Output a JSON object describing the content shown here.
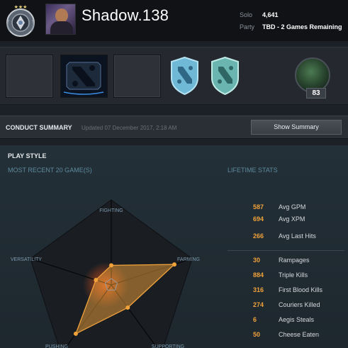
{
  "header": {
    "player_name": "Shadow.138",
    "stats": [
      {
        "label": "Solo",
        "value": "4,641"
      },
      {
        "label": "Party",
        "value": "TBD - 2 Games Remaining"
      }
    ],
    "rank_icon": "rank-medal-icon",
    "avatar_icon": "player-avatar"
  },
  "showcase": {
    "hero_level": "83",
    "hero_icon": "hero-portrait"
  },
  "conduct": {
    "title": "CONDUCT SUMMARY",
    "updated": "Updated 07 December 2017, 2:18 AM",
    "button_label": "Show Summary"
  },
  "playstyle": {
    "title": "PLAY STYLE",
    "subtitle": "MOST RECENT 20 GAME(S)",
    "lifetime_title": "LIFETIME STATS",
    "axes": [
      "FIGHTING",
      "FARMING",
      "SUPPORTING",
      "PUSHING",
      "VERSATILITY"
    ],
    "values": [
      0.23,
      0.78,
      0.33,
      0.71,
      0.19
    ],
    "accent_color": "#f0a23a"
  },
  "lifetime_stats": [
    {
      "value": "587",
      "label": "Avg GPM"
    },
    {
      "value": "694",
      "label": "Avg XPM"
    },
    {
      "value": "266",
      "label": "Avg Last Hits"
    },
    {
      "value": "30",
      "label": "Rampages"
    },
    {
      "value": "884",
      "label": "Triple Kills"
    },
    {
      "value": "316",
      "label": "First Blood Kills"
    },
    {
      "value": "274",
      "label": "Couriers Killed"
    },
    {
      "value": "6",
      "label": "Aegis Steals"
    },
    {
      "value": "50",
      "label": "Cheese Eaten"
    }
  ]
}
